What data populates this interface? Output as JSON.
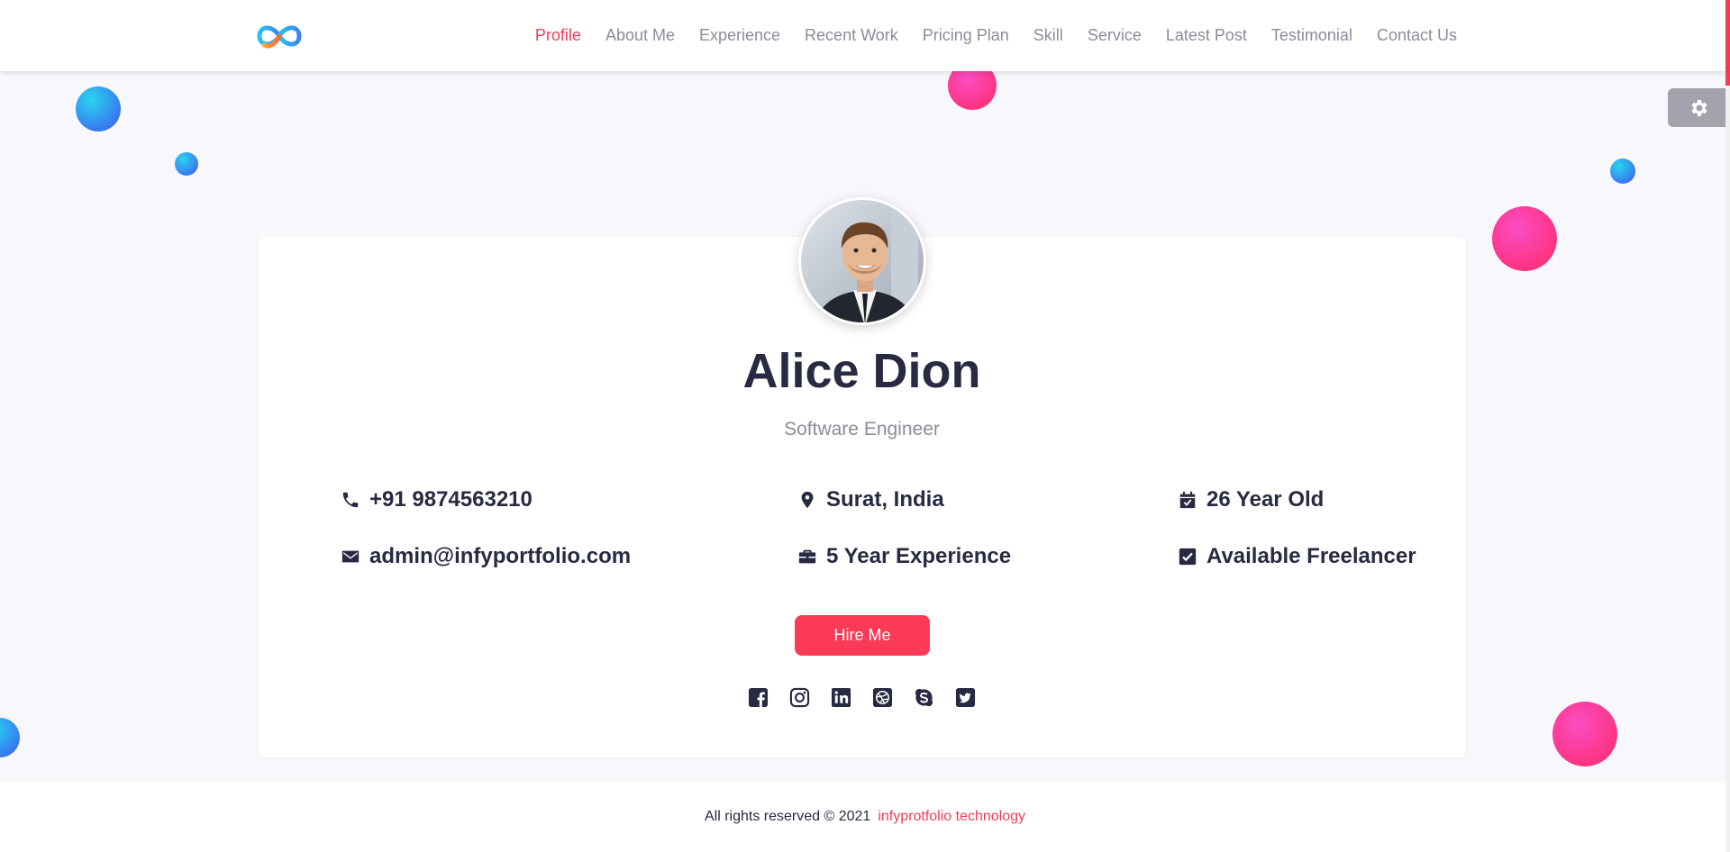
{
  "nav": {
    "items": [
      {
        "label": "Profile",
        "active": true
      },
      {
        "label": "About Me"
      },
      {
        "label": "Experience"
      },
      {
        "label": "Recent Work"
      },
      {
        "label": "Pricing Plan"
      },
      {
        "label": "Skill"
      },
      {
        "label": "Service"
      },
      {
        "label": "Latest Post"
      },
      {
        "label": "Testimonial"
      },
      {
        "label": "Contact Us"
      }
    ]
  },
  "profile": {
    "name": "Alice Dion",
    "role": "Software Engineer",
    "phone": "+91 9874563210",
    "email": "admin@infyportfolio.com",
    "location": "Surat, India",
    "experience": "5 Year Experience",
    "age": "26 Year Old",
    "freelance": "Available Freelancer",
    "hire_label": "Hire Me"
  },
  "socials": [
    "facebook-icon",
    "instagram-icon",
    "linkedin-icon",
    "dribbble-icon",
    "skype-icon",
    "twitter-icon"
  ],
  "footer": {
    "text": "All rights reserved © 2021",
    "brand": "infyprotfolio technology"
  },
  "colors": {
    "accent": "#f03c56",
    "dark": "#282a42",
    "muted": "#8c8c98",
    "background": "#f7f7fc"
  }
}
